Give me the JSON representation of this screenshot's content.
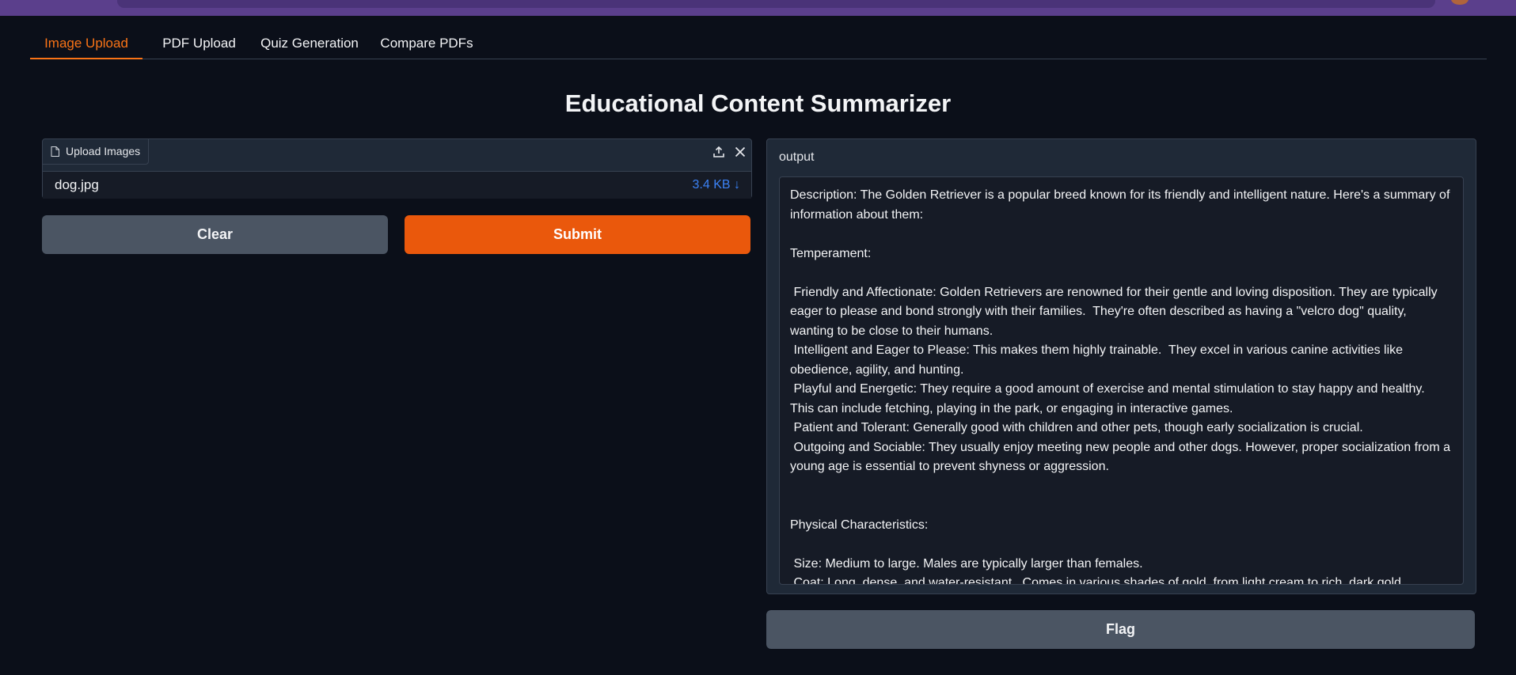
{
  "tabs": [
    {
      "label": "Image Upload",
      "active": true
    },
    {
      "label": "PDF Upload",
      "active": false
    },
    {
      "label": "Quiz Generation",
      "active": false
    },
    {
      "label": "Compare PDFs",
      "active": false
    }
  ],
  "page_title": "Educational Content Summarizer",
  "upload": {
    "label": "Upload Images",
    "file_name": "dog.jpg",
    "file_size": "3.4 KB ↓"
  },
  "buttons": {
    "clear": "Clear",
    "submit": "Submit",
    "flag": "Flag"
  },
  "output": {
    "label": "output",
    "text": "Description: The Golden Retriever is a popular breed known for its friendly and intelligent nature. Here's a summary of information about them:\n\nTemperament:\n\n Friendly and Affectionate: Golden Retrievers are renowned for their gentle and loving disposition. They are typically eager to please and bond strongly with their families.  They're often described as having a \"velcro dog\" quality, wanting to be close to their humans.\n Intelligent and Eager to Please: This makes them highly trainable.  They excel in various canine activities like obedience, agility, and hunting.\n Playful and Energetic: They require a good amount of exercise and mental stimulation to stay happy and healthy.  This can include fetching, playing in the park, or engaging in interactive games.\n Patient and Tolerant: Generally good with children and other pets, though early socialization is crucial.\n Outgoing and Sociable: They usually enjoy meeting new people and other dogs. However, proper socialization from a young age is essential to prevent shyness or aggression.\n\n\nPhysical Characteristics:\n\n Size: Medium to large. Males are typically larger than females.\n Coat: Long, dense, and water-resistant.  Comes in various shades of gold, from light cream to rich, dark gold."
  },
  "colors": {
    "accent": "#f97316",
    "primary_button": "#ea580c",
    "secondary_button": "#4b5563",
    "background": "#0b0f19",
    "link": "#3b82f6"
  },
  "icons": {
    "upload_label": "file-icon",
    "panel_actions": [
      "upload-icon",
      "close-icon"
    ]
  }
}
